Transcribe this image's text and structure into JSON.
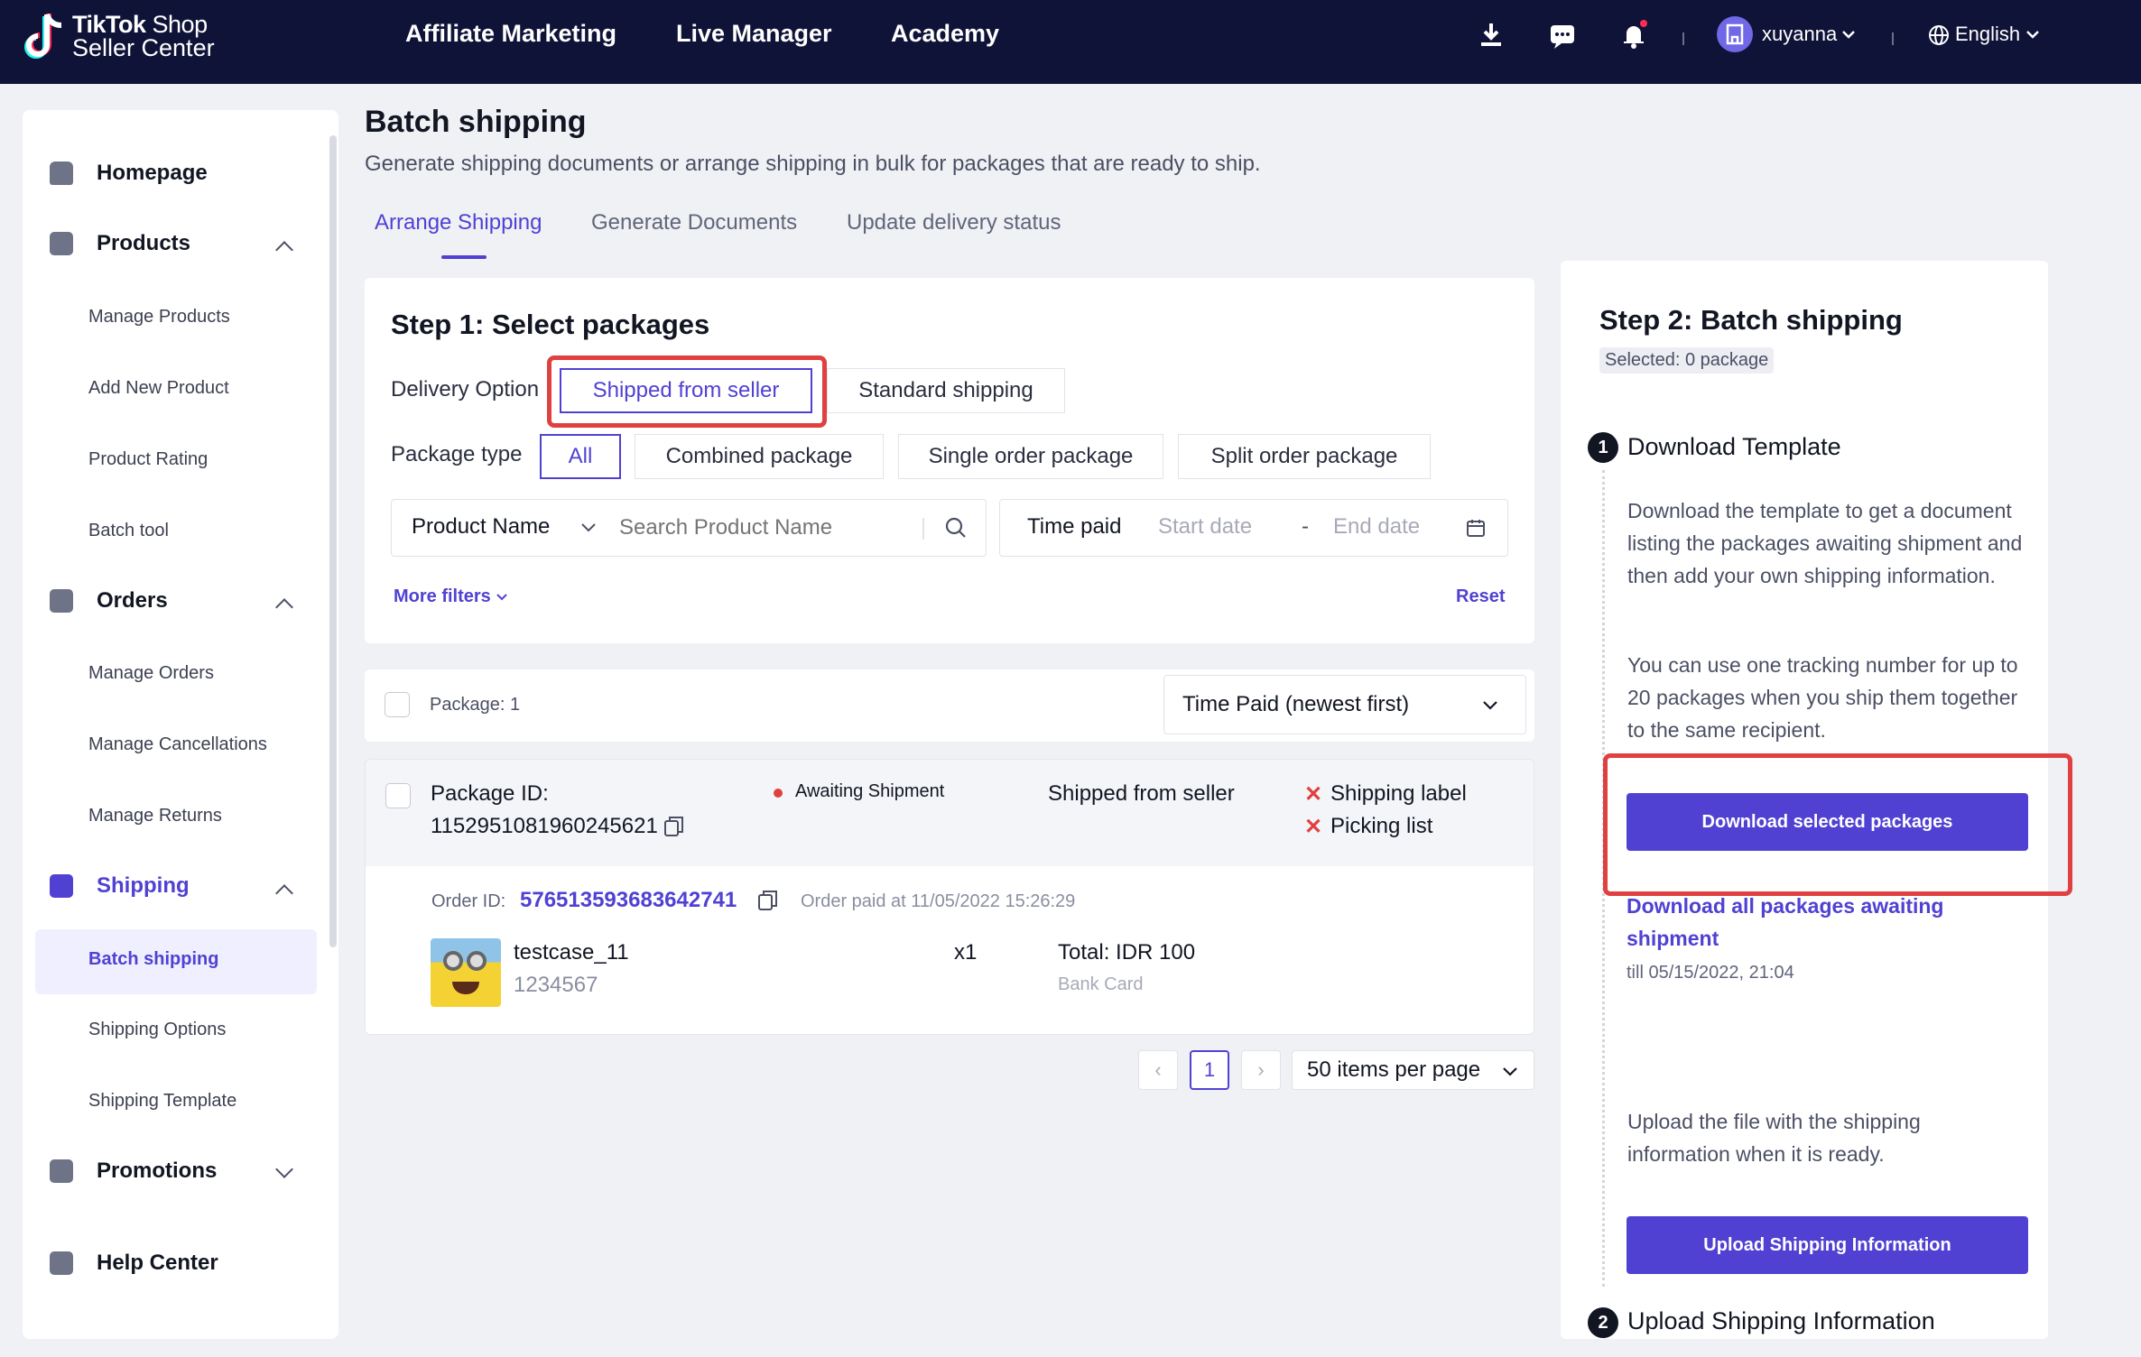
{
  "topbar": {
    "logo_line1": "TikTok",
    "logo_line1b": " Shop",
    "logo_line2": "Seller Center",
    "nav": [
      "Affiliate Marketing",
      "Live Manager",
      "Academy"
    ],
    "username": "xuyanna",
    "language": "English",
    "accent_bg": "#0f1338"
  },
  "sidebar": {
    "homepage": "Homepage",
    "products": {
      "label": "Products",
      "items": [
        "Manage Products",
        "Add New Product",
        "Product Rating",
        "Batch tool"
      ]
    },
    "orders": {
      "label": "Orders",
      "items": [
        "Manage Orders",
        "Manage Cancellations",
        "Manage Returns"
      ]
    },
    "shipping": {
      "label": "Shipping",
      "items": [
        "Batch shipping",
        "Shipping Options",
        "Shipping Template"
      ]
    },
    "promotions": "Promotions",
    "help": "Help Center"
  },
  "page": {
    "title": "Batch shipping",
    "subtitle": "Generate shipping documents or arrange shipping in bulk for packages that are ready to ship.",
    "tabs": [
      "Arrange Shipping",
      "Generate Documents",
      "Update delivery status"
    ]
  },
  "step1": {
    "title": "Step 1: Select packages",
    "delivery_label": "Delivery Option",
    "delivery_options": [
      "Shipped from seller",
      "Standard shipping"
    ],
    "package_type_label": "Package type",
    "package_types": [
      "All",
      "Combined package",
      "Single order package",
      "Split order package"
    ],
    "product_select": "Product Name",
    "search_placeholder": "Search Product Name",
    "time_label": "Time paid",
    "start_placeholder": "Start date",
    "date_sep": "-",
    "end_placeholder": "End date",
    "more_filters": "More filters",
    "reset": "Reset"
  },
  "list": {
    "package_count": "Package: 1",
    "sort": "Time Paid (newest first)",
    "package": {
      "id_label": "Package ID:",
      "id": "1152951081960245621",
      "status": "Awaiting Shipment",
      "delivery": "Shipped from seller",
      "docs": [
        "Shipping label",
        "Picking list"
      ],
      "order_label": "Order ID:",
      "order_id": "576513593683642741",
      "order_paid": "Order paid at 11/05/2022 15:26:29",
      "product_name": "testcase_11",
      "sku": "1234567",
      "qty": "x1",
      "total": "Total: IDR 100",
      "payment": "Bank Card"
    },
    "pagination": {
      "page": "1",
      "per_page": "50 items per page"
    }
  },
  "step2": {
    "title": "Step 2: Batch shipping",
    "selected": "Selected: 0 package",
    "s1_num": "1",
    "s1_title": "Download Template",
    "s1_p1": "Download the template to get a document listing the packages awaiting shipment and then add your own shipping information.",
    "s1_p2": "You can use one tracking number for up to 20 packages when you ship them together to the same recipient.",
    "download_selected": "Download selected packages",
    "download_all": "Download all packages awaiting shipment",
    "till": "till 05/15/2022, 21:04",
    "s2_num": "2",
    "s2_title": "Upload Shipping Information",
    "s2_p": "Upload the file with the shipping information when it is ready.",
    "upload_btn": "Upload Shipping Information"
  },
  "colors": {
    "primary": "#5041d3",
    "highlight": "#e0403f",
    "status_dot": "#e0403f"
  }
}
